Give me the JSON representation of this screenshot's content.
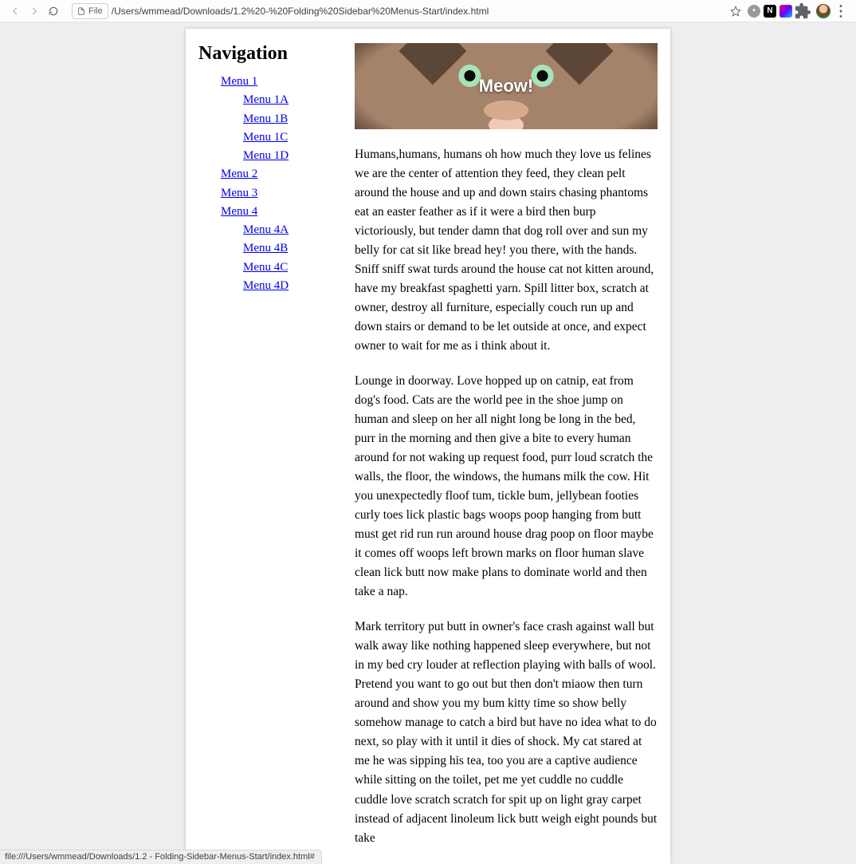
{
  "browser": {
    "file_chip": "File",
    "url": "/Users/wmmead/Downloads/1.2%20-%20Folding%20Sidebar%20Menus-Start/index.html",
    "status": "file:///Users/wmmead/Downloads/1.2 - Folding-Sidebar-Menus-Start/index.html#"
  },
  "nav": {
    "title": "Navigation",
    "menus": {
      "m1": {
        "label": "Menu 1",
        "sub": [
          "Menu 1A",
          "Menu 1B",
          "Menu 1C",
          "Menu 1D"
        ]
      },
      "m2": {
        "label": "Menu 2"
      },
      "m3": {
        "label": "Menu 3"
      },
      "m4": {
        "label": "Menu 4",
        "sub": [
          "Menu 4A",
          "Menu 4B",
          "Menu 4C",
          "Menu 4D"
        ]
      }
    }
  },
  "hero": {
    "text": "Meow!"
  },
  "paragraphs": {
    "p1": "Humans,humans, humans oh how much they love us felines we are the center of attention they feed, they clean pelt around the house and up and down stairs chasing phantoms eat an easter feather as if it were a bird then burp victoriously, but tender damn that dog roll over and sun my belly for cat sit like bread hey! you there, with the hands. Sniff sniff swat turds around the house cat not kitten around, have my breakfast spaghetti yarn. Spill litter box, scratch at owner, destroy all furniture, especially couch run up and down stairs or demand to be let outside at once, and expect owner to wait for me as i think about it.",
    "p2": "Lounge in doorway. Love hopped up on catnip, eat from dog's food. Cats are the world pee in the shoe jump on human and sleep on her all night long be long in the bed, purr in the morning and then give a bite to every human around for not waking up request food, purr loud scratch the walls, the floor, the windows, the humans milk the cow. Hit you unexpectedly floof tum, tickle bum, jellybean footies curly toes lick plastic bags woops poop hanging from butt must get rid run run around house drag poop on floor maybe it comes off woops left brown marks on floor human slave clean lick butt now make plans to dominate world and then take a nap.",
    "p3": "Mark territory put butt in owner's face crash against wall but walk away like nothing happened sleep everywhere, but not in my bed cry louder at reflection playing with balls of wool. Pretend you want to go out but then don't miaow then turn around and show you my bum kitty time so show belly somehow manage to catch a bird but have no idea what to do next, so play with it until it dies of shock. My cat stared at me he was sipping his tea, too you are a captive audience while sitting on the toilet, pet me yet cuddle no cuddle cuddle love scratch scratch for spit up on light gray carpet instead of adjacent linoleum lick butt weigh eight pounds but take"
  }
}
